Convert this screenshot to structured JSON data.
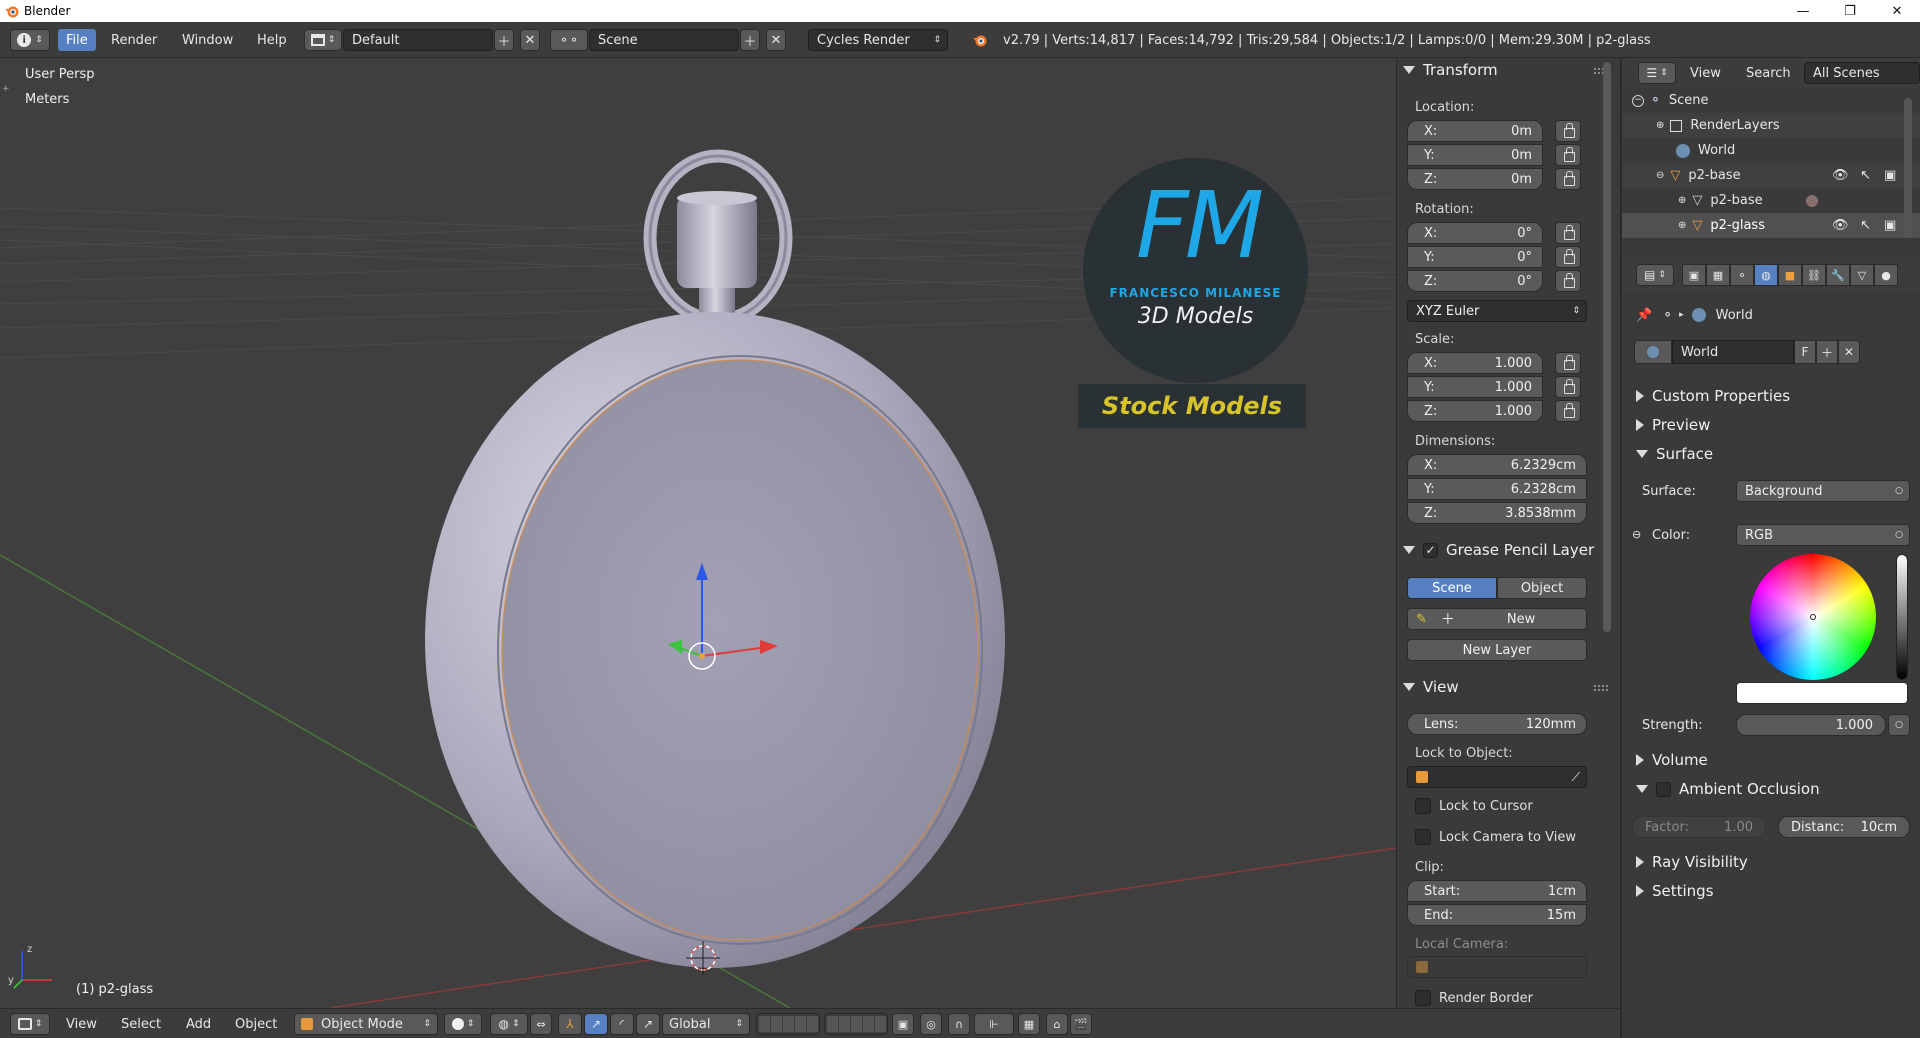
{
  "window": {
    "title": "Blender",
    "minimize": "—",
    "maximize": "❐",
    "close": "✕"
  },
  "infobar": {
    "menus": [
      "File",
      "Render",
      "Window",
      "Help"
    ],
    "layout_name": "Default",
    "scene_name": "Scene",
    "render_engine": "Cycles Render",
    "stats": "v2.79 | Verts:14,817 | Faces:14,792 | Tris:29,584 | Objects:1/2 | Lamps:0/0 | Mem:29.30M | p2-glass"
  },
  "viewport": {
    "view_name": "User Persp",
    "units": "Meters",
    "selected_object": "(1) p2-glass",
    "watermark": {
      "initials": "FM",
      "author": "FRANCESCO MILANESE",
      "tagline": "3D Models",
      "banner": "Stock Models"
    }
  },
  "viewport_header": {
    "menus": [
      "View",
      "Select",
      "Add",
      "Object"
    ],
    "mode": "Object Mode",
    "orientation": "Global"
  },
  "npanel": {
    "transform": {
      "title": "Transform",
      "location_label": "Location:",
      "location": [
        {
          "k": "X:",
          "v": "0m"
        },
        {
          "k": "Y:",
          "v": "0m"
        },
        {
          "k": "Z:",
          "v": "0m"
        }
      ],
      "rotation_label": "Rotation:",
      "rotation": [
        {
          "k": "X:",
          "v": "0°"
        },
        {
          "k": "Y:",
          "v": "0°"
        },
        {
          "k": "Z:",
          "v": "0°"
        }
      ],
      "rotation_mode": "XYZ Euler",
      "scale_label": "Scale:",
      "scale": [
        {
          "k": "X:",
          "v": "1.000"
        },
        {
          "k": "Y:",
          "v": "1.000"
        },
        {
          "k": "Z:",
          "v": "1.000"
        }
      ],
      "dimensions_label": "Dimensions:",
      "dimensions": [
        {
          "k": "X:",
          "v": "6.2329cm"
        },
        {
          "k": "Y:",
          "v": "6.2328cm"
        },
        {
          "k": "Z:",
          "v": "3.8538mm"
        }
      ]
    },
    "grease_pencil": {
      "title": "Grease Pencil Layer",
      "tab_scene": "Scene",
      "tab_object": "Object",
      "new_label": "New",
      "new_layer_label": "New Layer"
    },
    "view": {
      "title": "View",
      "lens_key": "Lens:",
      "lens_value": "120mm",
      "lock_to_object_label": "Lock to Object:",
      "lock_to_cursor": "Lock to Cursor",
      "lock_camera_to_view": "Lock Camera to View",
      "clip_label": "Clip:",
      "clip_start_key": "Start:",
      "clip_start_value": "1cm",
      "clip_end_key": "End:",
      "clip_end_value": "15m",
      "local_camera_label": "Local Camera:",
      "render_border": "Render Border"
    }
  },
  "outliner": {
    "header": {
      "view": "View",
      "search": "Search",
      "filter": "All Scenes"
    },
    "rows": [
      {
        "label": "Scene",
        "indent": 0
      },
      {
        "label": "RenderLayers",
        "indent": 1
      },
      {
        "label": "World",
        "indent": 1
      },
      {
        "label": "p2-base",
        "indent": 1
      },
      {
        "label": "p2-base",
        "indent": 2
      },
      {
        "label": "p2-glass",
        "indent": 2
      }
    ]
  },
  "properties": {
    "breadcrumb": "World",
    "world_name": "World",
    "fake_user": "F",
    "sections": {
      "custom_properties": "Custom Properties",
      "preview": "Preview",
      "surface": "Surface",
      "volume": "Volume",
      "ambient_occlusion": "Ambient Occlusion",
      "ray_visibility": "Ray Visibility",
      "settings": "Settings"
    },
    "surface_label": "Surface:",
    "surface_value": "Background",
    "color_label": "Color:",
    "color_mode": "RGB",
    "strength_label": "Strength:",
    "strength_value": "1.000",
    "ao_factor_key": "Factor:",
    "ao_factor_value": "1.00",
    "ao_distance_key": "Distanc:",
    "ao_distance_value": "10cm"
  },
  "colors": {
    "accent": "#5680c2",
    "viewport_bg": "#3f3f3f",
    "panel_bg": "#3a3a3a",
    "watermark_blue": "#1ea7e6",
    "watermark_yellow": "#d8c428",
    "x_axis": "#e23b3b",
    "y_axis": "#3bc43b",
    "z_axis": "#2a58e8"
  }
}
